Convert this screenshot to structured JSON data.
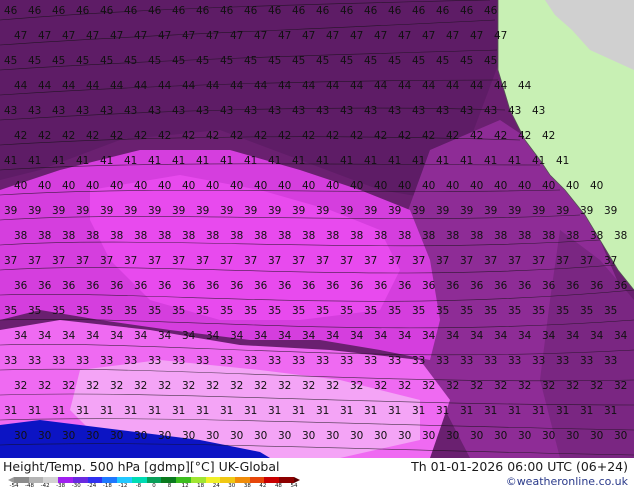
{
  "map": {
    "colors": {
      "ocean_deep": "#5d1a62",
      "region_dark": "#7a2a80",
      "region_mid": "#a83bb0",
      "region_magenta": "#e03ce8",
      "region_pink": "#f06cf0",
      "region_lightpink": "#f39cf5",
      "region_blue": "#0a10c8",
      "land_green": "#c8f0b4",
      "land_gray": "#d0d0d0",
      "contour_line": "#111111"
    },
    "contour_labels": [
      "46",
      "47",
      "45",
      "44",
      "43",
      "42",
      "41",
      "40",
      "39",
      "38",
      "37",
      "36",
      "35",
      "34",
      "33",
      "32",
      "31",
      "30"
    ]
  },
  "footer": {
    "title_left": "Height/Temp. 500 hPa [gdmp][°C] UK-Global",
    "title_right": "Th 01-01-2026 06:00 UTC (06+24)",
    "credit": "©weatheronline.co.uk",
    "colorbar": {
      "labels": [
        "-54",
        "-48",
        "-42",
        "-38",
        "-30",
        "-24",
        "-18",
        "-12",
        "-8",
        "0",
        "8",
        "12",
        "18",
        "24",
        "30",
        "38",
        "42",
        "48",
        "54"
      ],
      "colors": [
        "#8c8c8c",
        "#b4b4b4",
        "#d2d2d2",
        "#a020f0",
        "#6a2ae0",
        "#3030f0",
        "#1e78ff",
        "#22c8ff",
        "#00dcb4",
        "#08a05a",
        "#0a7a1e",
        "#3cbe1e",
        "#a0e632",
        "#f0f028",
        "#f0c814",
        "#f08c0a",
        "#e6460a",
        "#c80000",
        "#8c0000"
      ]
    }
  }
}
